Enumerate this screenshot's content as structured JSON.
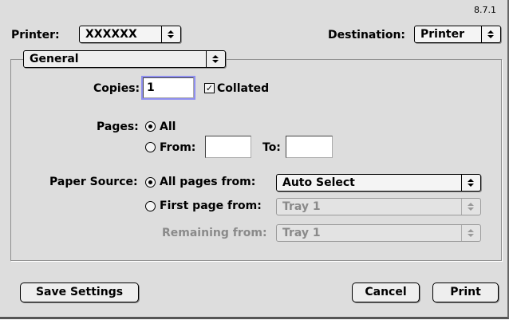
{
  "version": "8.7.1",
  "printer": {
    "label": "Printer:",
    "value": "XXXXXX"
  },
  "destination": {
    "label": "Destination:",
    "value": "Printer"
  },
  "panel_menu": {
    "value": "General"
  },
  "copies": {
    "label": "Copies:",
    "value": "1",
    "collated_label": "Collated",
    "collated": true
  },
  "pages": {
    "label": "Pages:",
    "all_label": "All",
    "from_label": "From:",
    "to_label": "To:",
    "from_value": "",
    "to_value": "",
    "selected": "All"
  },
  "paper_source": {
    "label": "Paper Source:",
    "all_pages_label": "All pages from:",
    "all_pages_value": "Auto Select",
    "first_page_label": "First page from:",
    "first_page_value": "Tray 1",
    "remaining_label": "Remaining from:",
    "remaining_value": "Tray 1",
    "selected": "All pages from:"
  },
  "buttons": {
    "save": "Save Settings",
    "cancel": "Cancel",
    "print": "Print"
  },
  "colors": {
    "dialog_bg": "#dddddd",
    "focus_ring": "#8f8ff0",
    "disabled_text": "#8a8a8a"
  }
}
